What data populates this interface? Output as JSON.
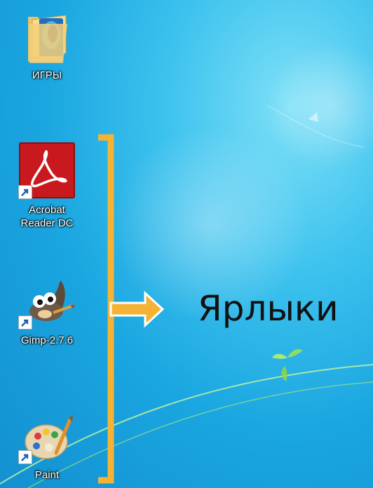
{
  "desktop": {
    "icons": [
      {
        "label": "ИГРЫ",
        "icon": "folder-icon",
        "type": "folder"
      },
      {
        "label": "Acrobat Reader DC",
        "icon": "acrobat-reader-icon",
        "type": "shortcut"
      },
      {
        "label": "Gimp-2.7.6",
        "icon": "gimp-icon",
        "type": "shortcut"
      },
      {
        "label": "Paint",
        "icon": "paint-icon",
        "type": "shortcut"
      }
    ]
  },
  "annotation": {
    "caption": "Ярлыки",
    "bracket_color": "#f5b335"
  },
  "colors": {
    "wallpaper": "#1aa6e0",
    "label_text": "#ffffff",
    "caption_text": "#111111"
  }
}
